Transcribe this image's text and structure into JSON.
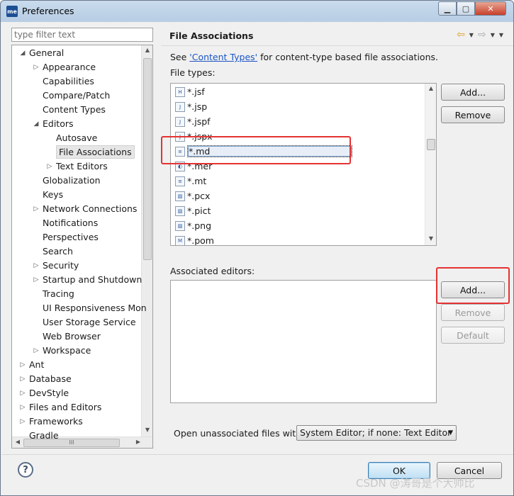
{
  "window": {
    "title": "Preferences",
    "app_icon_text": "me",
    "minimize": "▁",
    "maximize": "▢",
    "close": "✕"
  },
  "sidebar": {
    "filter_placeholder": "type filter text",
    "tree": [
      {
        "label": "General",
        "arrow": "◢",
        "indent": 0
      },
      {
        "label": "Appearance",
        "arrow": "▷",
        "indent": 1
      },
      {
        "label": "Capabilities",
        "arrow": "",
        "indent": 1
      },
      {
        "label": "Compare/Patch",
        "arrow": "",
        "indent": 1
      },
      {
        "label": "Content Types",
        "arrow": "",
        "indent": 1
      },
      {
        "label": "Editors",
        "arrow": "◢",
        "indent": 1
      },
      {
        "label": "Autosave",
        "arrow": "",
        "indent": 2
      },
      {
        "label": "File Associations",
        "arrow": "",
        "indent": 2,
        "selected": true
      },
      {
        "label": "Text Editors",
        "arrow": "▷",
        "indent": 2
      },
      {
        "label": "Globalization",
        "arrow": "",
        "indent": 1
      },
      {
        "label": "Keys",
        "arrow": "",
        "indent": 1
      },
      {
        "label": "Network Connections",
        "arrow": "▷",
        "indent": 1
      },
      {
        "label": "Notifications",
        "arrow": "",
        "indent": 1
      },
      {
        "label": "Perspectives",
        "arrow": "",
        "indent": 1
      },
      {
        "label": "Search",
        "arrow": "",
        "indent": 1
      },
      {
        "label": "Security",
        "arrow": "▷",
        "indent": 1
      },
      {
        "label": "Startup and Shutdown",
        "arrow": "▷",
        "indent": 1
      },
      {
        "label": "Tracing",
        "arrow": "",
        "indent": 1
      },
      {
        "label": "UI Responsiveness Mon",
        "arrow": "",
        "indent": 1
      },
      {
        "label": "User Storage Service",
        "arrow": "",
        "indent": 1
      },
      {
        "label": "Web Browser",
        "arrow": "",
        "indent": 1
      },
      {
        "label": "Workspace",
        "arrow": "▷",
        "indent": 1
      },
      {
        "label": "Ant",
        "arrow": "▷",
        "indent": 0
      },
      {
        "label": "Database",
        "arrow": "▷",
        "indent": 0
      },
      {
        "label": "DevStyle",
        "arrow": "▷",
        "indent": 0
      },
      {
        "label": "Files and Editors",
        "arrow": "▷",
        "indent": 0
      },
      {
        "label": "Frameworks",
        "arrow": "▷",
        "indent": 0
      },
      {
        "label": "Gradle",
        "arrow": "",
        "indent": 0
      }
    ]
  },
  "main": {
    "title": "File Associations",
    "see_prefix": "See ",
    "see_link": "'Content Types'",
    "see_suffix": " for content-type based file associations.",
    "file_types_label": "File types:",
    "file_types": [
      {
        "name": "*.jsf",
        "icon": "H"
      },
      {
        "name": "*.jsp",
        "icon": "J"
      },
      {
        "name": "*.jspf",
        "icon": "J"
      },
      {
        "name": "*.jspx",
        "icon": "J"
      },
      {
        "name": "*.md",
        "icon": "≡",
        "selected": true
      },
      {
        "name": "*.mer",
        "icon": "◐"
      },
      {
        "name": "*.mt",
        "icon": "≡"
      },
      {
        "name": "*.pcx",
        "icon": "▨"
      },
      {
        "name": "*.pict",
        "icon": "▨"
      },
      {
        "name": "*.png",
        "icon": "▨"
      },
      {
        "name": "*.pom",
        "icon": "M"
      }
    ],
    "associated_label": "Associated editors:",
    "buttons": {
      "add_types": "Add...",
      "remove_types": "Remove",
      "add_editors": "Add...",
      "remove_editors": "Remove",
      "default_editors": "Default"
    },
    "open_unassociated_label": "Open unassociated files with:",
    "open_unassociated_value": "System Editor; if none: Text Editor"
  },
  "footer": {
    "help": "?",
    "ok": "OK",
    "cancel": "Cancel"
  },
  "watermark": "CSDN @涛哥是个大帅比"
}
